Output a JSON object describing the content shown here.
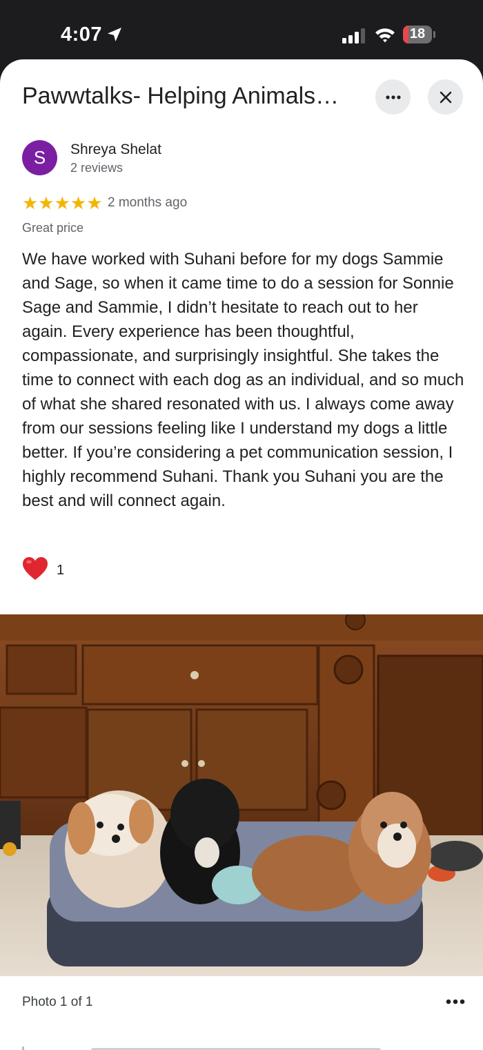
{
  "status_bar": {
    "time": "4:07",
    "battery": "18",
    "battery_level_percent": 18
  },
  "sheet": {
    "title": "Pawwtalks- Helping Animals…"
  },
  "review": {
    "avatar_letter": "S",
    "reviewer_name": "Shreya Shelat",
    "reviewer_reviews": "2 reviews",
    "rating": 5,
    "stars": "★★★★★",
    "time_ago": "2 months ago",
    "attribute": "Great price",
    "text": "We have  worked with Suhani before for my dogs Sammie and Sage, so when it came time to do a session for Sonnie Sage and Sammie,  I didn’t hesitate to reach out to her again. Every experience has been thoughtful, compassionate, and surprisingly insightful. She takes the time to connect with each dog as an individual, and so much of what she shared resonated with us. I always come away from our sessions feeling like I understand my dogs a little better. If you’re considering a pet communication session, I highly recommend Suhani. Thank you Suhani you are the best and will connect again.",
    "reaction_count": "1"
  },
  "photo": {
    "caption": "Photo 1 of 1"
  },
  "colors": {
    "avatar": "#7b1fa2",
    "stars": "#f4b400",
    "heart": "#e0262f",
    "battery": "#e5484d"
  },
  "icons": [
    "location-arrow-icon",
    "cellular-signal-icon",
    "wifi-icon",
    "battery-icon",
    "more-horizontal-icon",
    "close-icon",
    "star-icon",
    "heart-icon"
  ]
}
